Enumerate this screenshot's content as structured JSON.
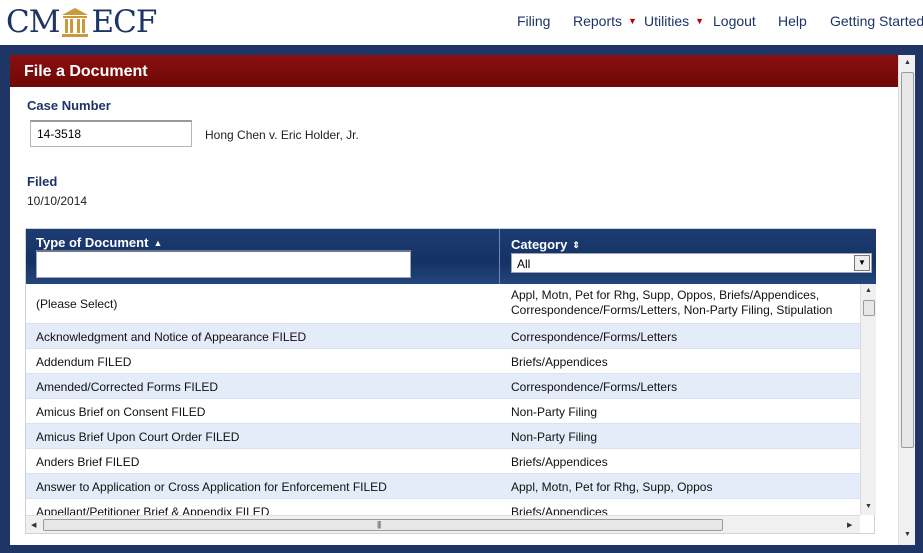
{
  "app": {
    "logo_left": "CM",
    "logo_right": "ECF"
  },
  "nav": [
    {
      "label": "Filing",
      "has_dropdown": false
    },
    {
      "label": "Reports",
      "has_dropdown": true
    },
    {
      "label": "Utilities",
      "has_dropdown": true
    },
    {
      "label": "Logout",
      "has_dropdown": false
    },
    {
      "label": "Help",
      "has_dropdown": false
    },
    {
      "label": "Getting Started",
      "has_dropdown": false
    }
  ],
  "panel": {
    "title": "File a Document",
    "case_number_label": "Case Number",
    "case_number_value": "14-3518",
    "case_caption": "Hong Chen v. Eric Holder, Jr.",
    "filed_label": "Filed",
    "filed_date": "10/10/2014"
  },
  "table": {
    "col1_header": "Type of Document",
    "col1_sort_icon": "▲",
    "col2_header": "Category",
    "col2_sort_icon": "⇕",
    "filter_value": "",
    "category_selected": "All",
    "rows": [
      {
        "type": "(Please Select)",
        "category_line1": "Appl, Motn, Pet for Rhg, Supp, Oppos, Briefs/Appendices,",
        "category_line2": "Correspondence/Forms/Letters, Non-Party Filing, Stipulation"
      },
      {
        "type": "Acknowledgment and Notice of Appearance FILED",
        "category": "Correspondence/Forms/Letters"
      },
      {
        "type": "Addendum FILED",
        "category": "Briefs/Appendices"
      },
      {
        "type": "Amended/Corrected Forms FILED",
        "category": "Correspondence/Forms/Letters"
      },
      {
        "type": "Amicus Brief on Consent FILED",
        "category": "Non-Party Filing"
      },
      {
        "type": "Amicus Brief Upon Court Order FILED",
        "category": "Non-Party Filing"
      },
      {
        "type": "Anders Brief FILED",
        "category": "Briefs/Appendices"
      },
      {
        "type": "Answer to Application or Cross Application for Enforcement FILED",
        "category": "Appl, Motn, Pet for Rhg, Supp, Oppos"
      },
      {
        "type": "Appellant/Petitioner Brief & Appendix FILED",
        "category": "Briefs/Appendices"
      }
    ]
  },
  "colors": {
    "brand_navy": "#1e3366",
    "header_red": "#7d0b0b",
    "row_alt": "#e3ecf8",
    "caret_red": "#c00000"
  },
  "icons": {
    "logo": "courthouse-pillar-icon",
    "dropdown": "caret-down-icon",
    "sort_asc": "sort-asc-icon",
    "sort_both": "sort-both-icon"
  }
}
